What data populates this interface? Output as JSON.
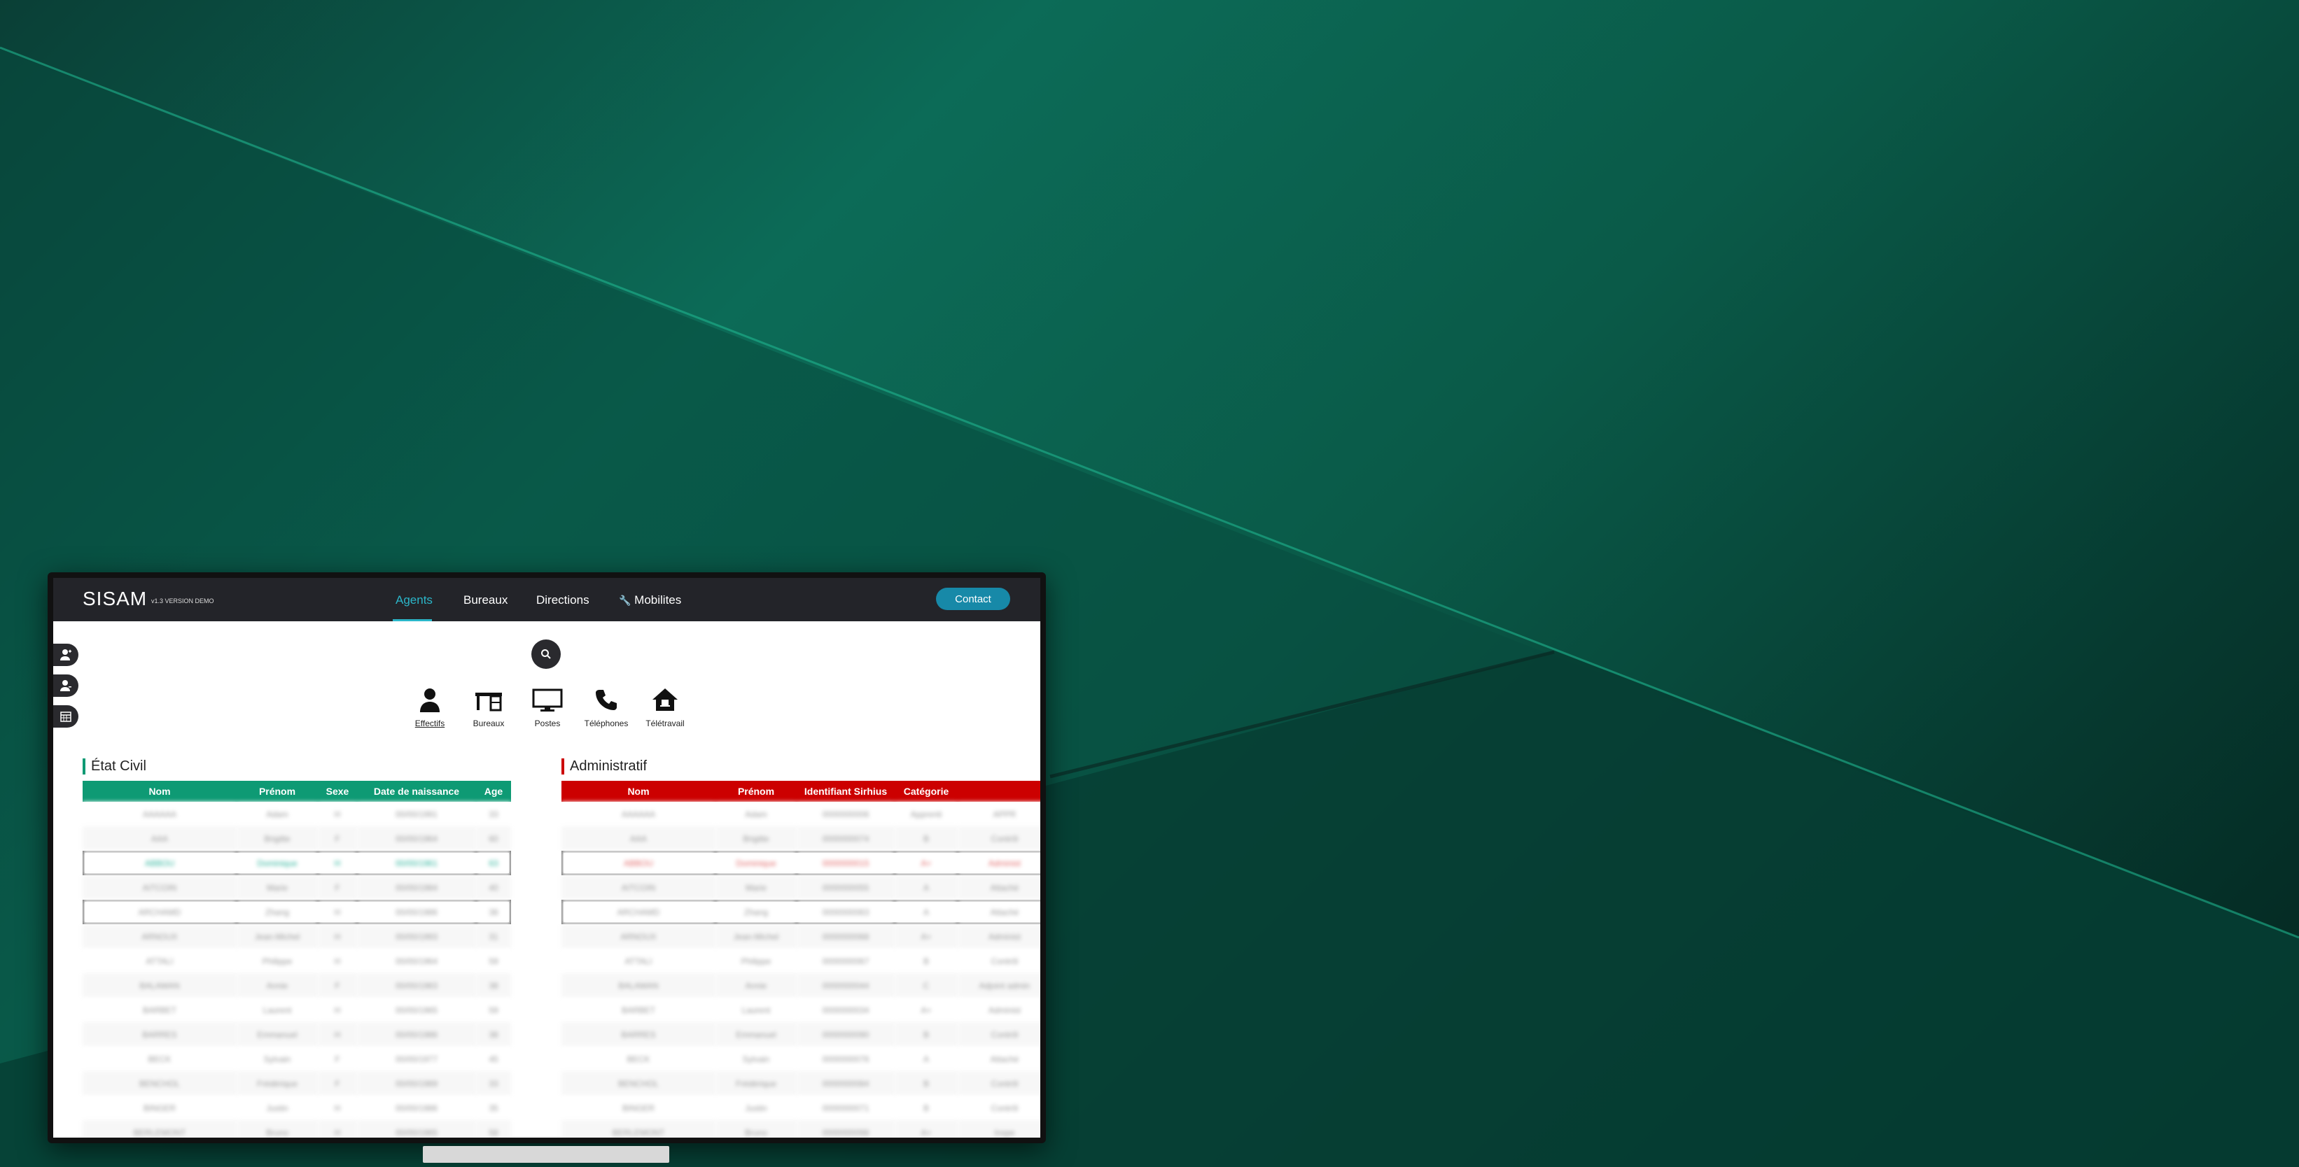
{
  "app": {
    "brand": "SISAM",
    "brand_sub": "v1.3 VERSION DEMO",
    "nav": [
      {
        "label": "Agents",
        "active": true
      },
      {
        "label": "Bureaux",
        "active": false
      },
      {
        "label": "Directions",
        "active": false
      },
      {
        "label": "Mobilites",
        "active": false,
        "icon": "wrench-icon"
      }
    ],
    "contact_label": "Contact",
    "accent": "#2bb6c9",
    "contact_color": "#1789a8"
  },
  "categories": [
    {
      "label": "Effectifs",
      "icon": "person-icon",
      "active": true
    },
    {
      "label": "Bureaux",
      "icon": "desk-icon",
      "active": false
    },
    {
      "label": "Postes",
      "icon": "monitor-icon",
      "active": false
    },
    {
      "label": "Téléphones",
      "icon": "phone-icon",
      "active": false
    },
    {
      "label": "Télétravail",
      "icon": "home-icon",
      "active": false
    }
  ],
  "etat_civil": {
    "title": "État Civil",
    "color": "#0e9a74",
    "headers": [
      "Nom",
      "Prénom",
      "Sexe",
      "Date de naissance",
      "Age"
    ],
    "rows": [
      [
        "AAAAAA",
        "Adam",
        "H",
        "00/00/1991",
        "33"
      ],
      [
        "AAA",
        "Brigitte",
        "F",
        "00/00/1964",
        "60"
      ],
      [
        "ABBOU",
        "Dominique",
        "H",
        "00/00/1961",
        "63"
      ],
      [
        "AITCOIN",
        "Marie",
        "F",
        "00/00/1984",
        "40"
      ],
      [
        "ARCHAMD",
        "Zhang",
        "H",
        "00/00/1986",
        "38"
      ],
      [
        "ARNOUX",
        "Jean-Michel",
        "H",
        "00/00/1993",
        "31"
      ],
      [
        "ATTALI",
        "Philippe",
        "H",
        "00/00/1964",
        "59"
      ],
      [
        "BALAMAN",
        "Annie",
        "F",
        "00/00/1983",
        "38"
      ],
      [
        "BARBET",
        "Laurent",
        "H",
        "00/00/1965",
        "59"
      ],
      [
        "BARRES",
        "Emmanuel",
        "H",
        "00/00/1986",
        "38"
      ],
      [
        "BECK",
        "Sylvain",
        "F",
        "00/00/1977",
        "45"
      ],
      [
        "BENCHOL",
        "Frédérique",
        "F",
        "00/00/1989",
        "33"
      ],
      [
        "BINGER",
        "Justin",
        "H",
        "00/00/1986",
        "35"
      ],
      [
        "BERLEMONT",
        "Bruno",
        "H",
        "00/00/1965",
        "58"
      ]
    ]
  },
  "administratif": {
    "title": "Administratif",
    "color": "#cc0000",
    "headers": [
      "Nom",
      "Prénom",
      "Identifiant Sirhius",
      "Catégorie",
      ""
    ],
    "rows": [
      [
        "AAAAAA",
        "Adam",
        "0000000006",
        "Apprenti",
        "APPR"
      ],
      [
        "AAA",
        "Brigitte",
        "0000000074",
        "B",
        "Contrôl"
      ],
      [
        "ABBOU",
        "Dominique",
        "0000000015",
        "A+",
        "Administ"
      ],
      [
        "AITCOIN",
        "Marie",
        "0000000055",
        "A",
        "Attaché"
      ],
      [
        "ARCHAMD",
        "Zhang",
        "0000000063",
        "A",
        "Attaché"
      ],
      [
        "ARNOUX",
        "Jean-Michel",
        "0000000068",
        "A+",
        "Administ"
      ],
      [
        "ATTALI",
        "Philippe",
        "0000000067",
        "B",
        "Contrôl"
      ],
      [
        "BALAMAN",
        "Annie",
        "0000000044",
        "C",
        "Adjoint admin"
      ],
      [
        "BARBET",
        "Laurent",
        "0000000034",
        "A+",
        "Administ"
      ],
      [
        "BARRES",
        "Emmanuel",
        "0000000090",
        "B",
        "Contrôl"
      ],
      [
        "BECK",
        "Sylvain",
        "0000000076",
        "A",
        "Attaché"
      ],
      [
        "BENCHOL",
        "Frédérique",
        "0000000084",
        "B",
        "Contrôl"
      ],
      [
        "BINGER",
        "Justin",
        "0000000071",
        "B",
        "Contrôl"
      ],
      [
        "BERLEMONT",
        "Bruno",
        "0000000098",
        "A+",
        "Inspe"
      ]
    ]
  }
}
